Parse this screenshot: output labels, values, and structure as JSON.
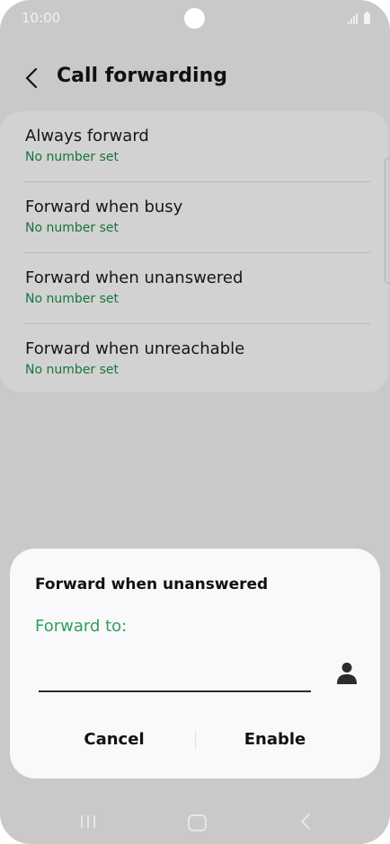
{
  "status_bar": {
    "time": "10:00"
  },
  "header": {
    "title": "Call forwarding"
  },
  "forwarding_options": [
    {
      "title": "Always forward",
      "status": "No number set"
    },
    {
      "title": "Forward when busy",
      "status": "No number set"
    },
    {
      "title": "Forward when unanswered",
      "status": "No number set"
    },
    {
      "title": "Forward when unreachable",
      "status": "No number set"
    }
  ],
  "dialog": {
    "title": "Forward when unanswered",
    "label": "Forward to:",
    "input_value": "",
    "cancel_label": "Cancel",
    "enable_label": "Enable"
  },
  "colors": {
    "accent_green": "#2f9e5a",
    "status_green": "#15753f",
    "dimmed_background": "#c9c9c9"
  },
  "icons": {
    "back": "chevron-left-icon",
    "contact": "person-icon",
    "nav_recent": "recent-apps-icon",
    "nav_home": "home-icon",
    "nav_back": "back-icon"
  }
}
